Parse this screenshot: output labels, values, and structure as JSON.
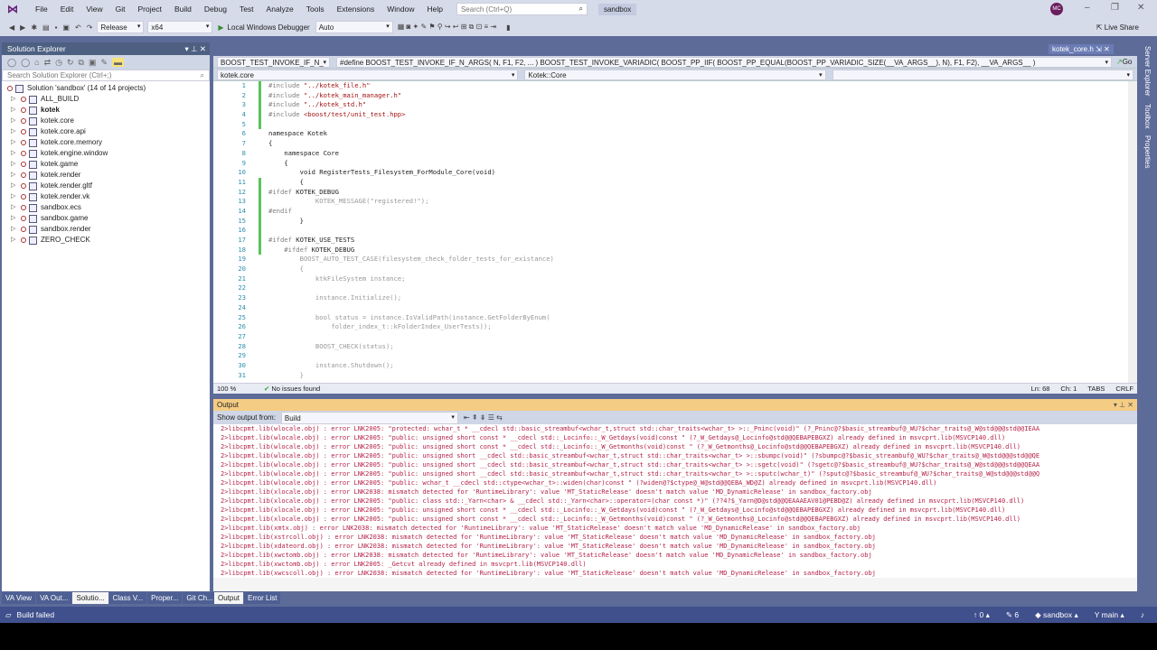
{
  "titlebar": {
    "menus": [
      "File",
      "Edit",
      "View",
      "Git",
      "Project",
      "Build",
      "Debug",
      "Test",
      "Analyze",
      "Tools",
      "Extensions",
      "Window",
      "Help"
    ],
    "search_placeholder": "Search (Ctrl+Q)",
    "solution": "sandbox",
    "avatar": "MC",
    "min": "–",
    "max": "❐",
    "close": "✕"
  },
  "toolbar": {
    "config": "Release",
    "platform": "x64",
    "debugger": "Local Windows Debugger",
    "debugger_mode": "Auto",
    "live_share": "Live Share"
  },
  "solution_explorer": {
    "title": "Solution Explorer",
    "search_placeholder": "Search Solution Explorer (Ctrl+;)",
    "root": "Solution 'sandbox' (14 of 14 projects)",
    "projects": [
      "ALL_BUILD",
      "kotek",
      "kotek.core",
      "kotek.core.api",
      "kotek.core.memory",
      "kotek.engine.window",
      "kotek.game",
      "kotek.render",
      "kotek.render.gltf",
      "kotek.render.vk",
      "sandbox.ecs",
      "sandbox.game",
      "sandbox.render",
      "ZERO_CHECK"
    ],
    "startup": "kotek"
  },
  "left_tabs": [
    "VA View",
    "VA Out...",
    "Solutio...",
    "Class V...",
    "Proper...",
    "Git Ch..."
  ],
  "editor": {
    "tabs": "TABS",
    "active_tab": 1,
    "preview_tab": "kotek_core.h",
    "nav_symbol": "BOOST_TEST_INVOKE_IF_N_",
    "nav_define": "#define BOOST_TEST_INVOKE_IF_N_ARGS( N, F1, F2, ... ) BOOST_TEST_INVOKE_VARIADIC( BOOST_PP_IIF( BOOST_PP_EQUAL(BOOST_PP_VARIADIC_SIZE(__VA_ARGS__), N), F1, F2), __VA_ARGS__ )",
    "go": "Go",
    "project_combo": "kotek.core",
    "scope_combo": "Kotek::Core",
    "lines": [
      [
        "#include ",
        "pre",
        "\"../kotek_file.h\"",
        "str"
      ],
      [
        "#include ",
        "pre",
        "\"../kotek_main_manager.h\"",
        "str"
      ],
      [
        "#include ",
        "pre",
        "\"../kotek_std.h\"",
        "str"
      ],
      [
        "#include ",
        "pre",
        "<boost/test/unit_test.hpp>",
        "str"
      ],
      [
        "",
        "kw",
        "",
        ""
      ],
      [
        "namespace Kotek",
        "kw",
        "",
        ""
      ],
      [
        "{",
        "kw",
        "",
        ""
      ],
      [
        "    namespace Core",
        "kw",
        "",
        ""
      ],
      [
        "    {",
        "kw",
        "",
        ""
      ],
      [
        "        void RegisterTests_Filesystem_ForModule_Core(void)",
        "kw",
        "",
        ""
      ],
      [
        "        {",
        "kw",
        "",
        ""
      ],
      [
        "#ifdef ",
        "pre",
        "KOTEK_DEBUG",
        "kw"
      ],
      [
        "            KOTEK_MESSAGE(\"registered!\");",
        "gr",
        "",
        ""
      ],
      [
        "#endif",
        "pre",
        "",
        ""
      ],
      [
        "        }",
        "kw",
        "",
        ""
      ],
      [
        "",
        "kw",
        "",
        ""
      ],
      [
        "#ifdef ",
        "pre",
        "KOTEK_USE_TESTS",
        "kw"
      ],
      [
        "    #ifdef ",
        "pre",
        "KOTEK_DEBUG",
        "kw"
      ],
      [
        "        BOOST_AUTO_TEST_CASE(filesystem_check_folder_tests_for_existance)",
        "gr",
        "",
        ""
      ],
      [
        "        {",
        "gr",
        "",
        ""
      ],
      [
        "            ktkFileSystem instance;",
        "gr",
        "",
        ""
      ],
      [
        "",
        "gr",
        "",
        ""
      ],
      [
        "            instance.Initialize();",
        "gr",
        "",
        ""
      ],
      [
        "",
        "gr",
        "",
        ""
      ],
      [
        "            bool status = instance.IsValidPath(instance.GetFolderByEnum(",
        "gr",
        "",
        ""
      ],
      [
        "                folder_index_t::kFolderIndex_UserTests));",
        "gr",
        "",
        ""
      ],
      [
        "",
        "gr",
        "",
        ""
      ],
      [
        "            BOOST_CHECK(status);",
        "gr",
        "",
        ""
      ],
      [
        "",
        "gr",
        "",
        ""
      ],
      [
        "            instance.Shutdown();",
        "gr",
        "",
        ""
      ],
      [
        "        }",
        "gr",
        "",
        ""
      ]
    ],
    "zoom": "100 %",
    "issues": "No issues found",
    "ln": "Ln: 68",
    "ch": "Ch: 1",
    "eol": "CRLF"
  },
  "output": {
    "title": "Output",
    "show_from_label": "Show output from:",
    "source": "Build",
    "lines": [
      "2>libcpmt.lib(wlocale.obj) : error LNK2005: \"protected: wchar_t * __cdecl std::basic_streambuf<wchar_t,struct std::char_traits<wchar_t> >::_Pninc(void)\" (?_Pninc@?$basic_streambuf@_WU?$char_traits@_W@std@@@std@@IEAA",
      "2>libcpmt.lib(wlocale.obj) : error LNK2005: \"public: unsigned short const * __cdecl std::_Locinfo::_W_Getdays(void)const \" (?_W_Getdays@_Locinfo@std@@QEBAPEBGXZ) already defined in msvcprt.lib(MSVCP140.dll)",
      "2>libcpmt.lib(wlocale.obj) : error LNK2005: \"public: unsigned short const * __cdecl std::_Locinfo::_W_Getmonths(void)const \" (?_W_Getmonths@_Locinfo@std@@QEBAPEBGXZ) already defined in msvcprt.lib(MSVCP140.dll)",
      "2>libcpmt.lib(wlocale.obj) : error LNK2005: \"public: unsigned short __cdecl std::basic_streambuf<wchar_t,struct std::char_traits<wchar_t> >::sbumpc(void)\" (?sbumpc@?$basic_streambuf@_WU?$char_traits@_W@std@@@std@@QE",
      "2>libcpmt.lib(wlocale.obj) : error LNK2005: \"public: unsigned short __cdecl std::basic_streambuf<wchar_t,struct std::char_traits<wchar_t> >::sgetc(void)\" (?sgetc@?$basic_streambuf@_WU?$char_traits@_W@std@@@std@@QEAA",
      "2>libcpmt.lib(wlocale.obj) : error LNK2005: \"public: unsigned short __cdecl std::basic_streambuf<wchar_t,struct std::char_traits<wchar_t> >::sputc(wchar_t)\" (?sputc@?$basic_streambuf@_WU?$char_traits@_W@std@@@std@@Q",
      "2>libcpmt.lib(wlocale.obj) : error LNK2005: \"public: wchar_t __cdecl std::ctype<wchar_t>::widen(char)const \" (?widen@?$ctype@_W@std@@QEBA_WD@Z) already defined in msvcprt.lib(MSVCP140.dll)",
      "2>libcpmt.lib(xlocale.obj) : error LNK2038: mismatch detected for 'RuntimeLibrary': value 'MT_StaticRelease' doesn't match value 'MD_DynamicRelease' in sandbox_factory.obj",
      "2>libcpmt.lib(xlocale.obj) : error LNK2005: \"public: class std::_Yarn<char> & __cdecl std::_Yarn<char>::operator=(char const *)\" (??4?$_Yarn@D@std@@QEAAAEAV01@PEBD@Z) already defined in msvcprt.lib(MSVCP140.dll)",
      "2>libcpmt.lib(xlocale.obj) : error LNK2005: \"public: unsigned short const * __cdecl std::_Locinfo::_W_Getdays(void)const \" (?_W_Getdays@_Locinfo@std@@QEBAPEBGXZ) already defined in msvcprt.lib(MSVCP140.dll)",
      "2>libcpmt.lib(xlocale.obj) : error LNK2005: \"public: unsigned short const * __cdecl std::_Locinfo::_W_Getmonths(void)const \" (?_W_Getmonths@_Locinfo@std@@QEBAPEBGXZ) already defined in msvcprt.lib(MSVCP140.dll)",
      "2>libcpmt.lib(xmtx.obj) : error LNK2038: mismatch detected for 'RuntimeLibrary': value 'MT_StaticRelease' doesn't match value 'MD_DynamicRelease' in sandbox_factory.obj",
      "2>libcpmt.lib(xstrcoll.obj) : error LNK2038: mismatch detected for 'RuntimeLibrary': value 'MT_StaticRelease' doesn't match value 'MD_DynamicRelease' in sandbox_factory.obj",
      "2>libcpmt.lib(xdateord.obj) : error LNK2038: mismatch detected for 'RuntimeLibrary': value 'MT_StaticRelease' doesn't match value 'MD_DynamicRelease' in sandbox_factory.obj",
      "2>libcpmt.lib(xwctomb.obj) : error LNK2038: mismatch detected for 'RuntimeLibrary': value 'MT_StaticRelease' doesn't match value 'MD_DynamicRelease' in sandbox_factory.obj",
      "2>libcpmt.lib(xwctomb.obj) : error LNK2005: _Getcvt already defined in msvcprt.lib(MSVCP140.dll)",
      "2>libcpmt.lib(xwcscoll.obj) : error LNK2038: mismatch detected for 'RuntimeLibrary': value 'MT_StaticRelease' doesn't match value 'MD_DynamicRelease' in sandbox_factory.obj"
    ],
    "tabs": [
      "Output",
      "Error List"
    ]
  },
  "right_tabs": [
    "Server Explorer",
    "Toolbox",
    "Properties"
  ],
  "statusbar": {
    "message": "Build failed",
    "push": "0",
    "changes": "6",
    "repo": "sandbox",
    "branch": "main"
  }
}
